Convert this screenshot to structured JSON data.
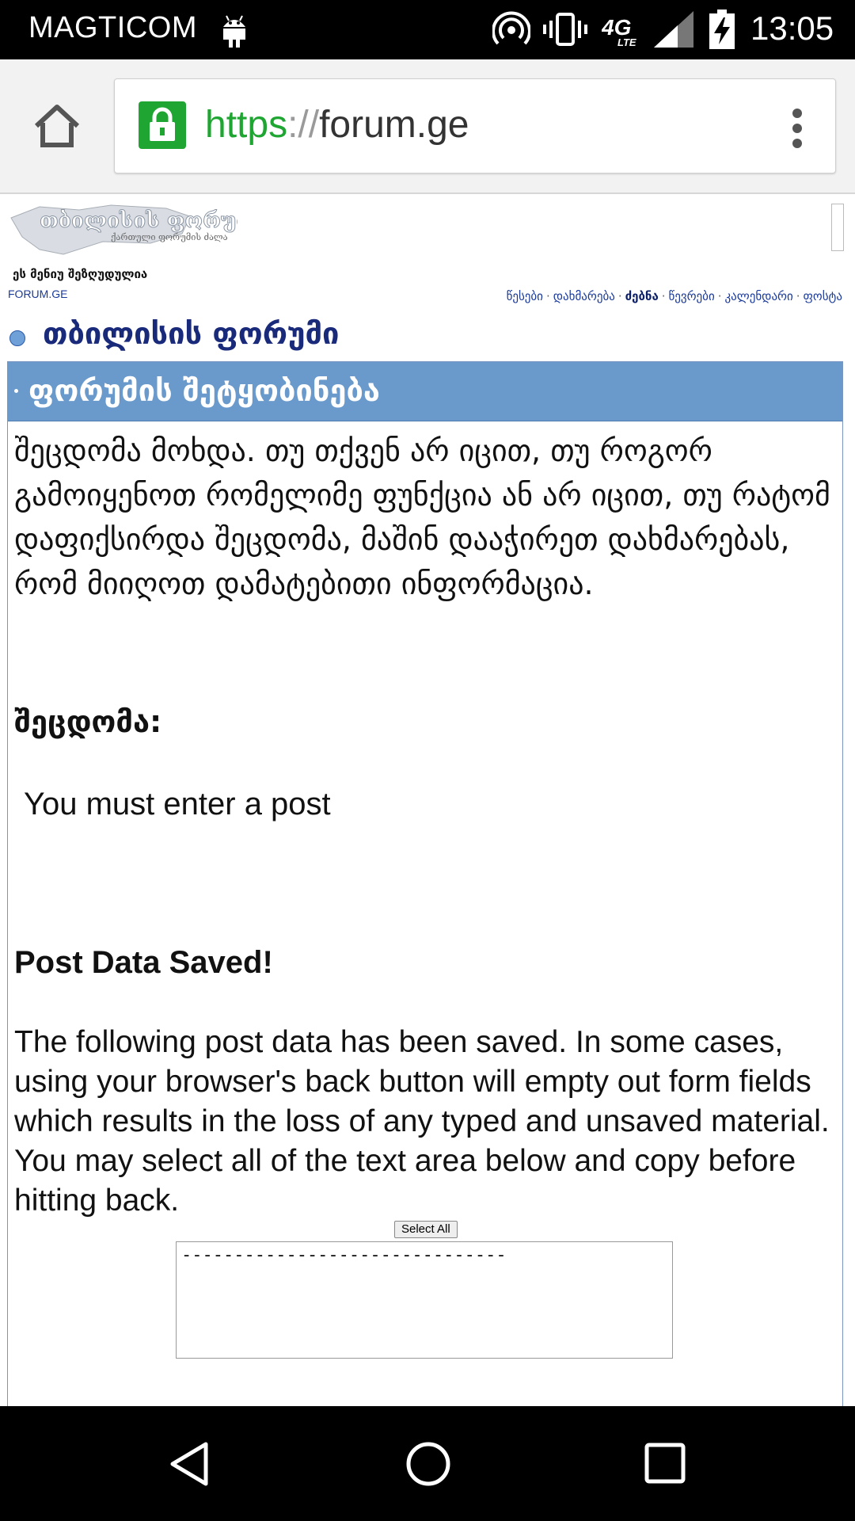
{
  "status_bar": {
    "carrier": "MAGTICOM",
    "network_badge": "4G LTE",
    "time": "13:05",
    "icons": [
      "android-icon",
      "hotspot-icon",
      "vibrate-icon",
      "lte-icon",
      "signal-icon",
      "battery-charging-icon"
    ]
  },
  "browser": {
    "url_scheme": "https",
    "url_sep": "://",
    "url_host": "forum.ge",
    "accent_color": "#1fa632"
  },
  "header": {
    "logo_text": "თბილისის ფორუმი",
    "logo_subtext": "ქართული ფორუმის ძალა",
    "menu_limited": "ეს მენიუ შეზღუდულია",
    "site_link": "FORUM.GE",
    "nav": [
      {
        "label": "წესები"
      },
      {
        "label": "დახმარება"
      },
      {
        "label": "ძებნა"
      },
      {
        "label": "წევრები"
      },
      {
        "label": "კალენდარი"
      },
      {
        "label": "ფოსტა"
      }
    ]
  },
  "forum": {
    "title": "თბილისის ფორუმი"
  },
  "message": {
    "header": "ფორუმის შეტყობინება",
    "intro": "შეცდომა მოხდა. თუ თქვენ არ იცით, თუ როგორ გამოიყენოთ რომელიმე ფუნქცია ან არ იცით, თუ რატომ დაფიქსირდა შეცდომა, მაშინ დააჭირეთ დახმარებას, რომ მიიღოთ დამატებითი ინფორმაცია.",
    "error_label": "შეცდომა:",
    "error_text": "You must enter a post",
    "saved_title": "Post Data Saved!",
    "saved_desc": "The following post data has been saved. In some cases, using your browser's back button will empty out form fields which results in the loss of any typed and unsaved material. You may select all of the text area below and copy before hitting back.",
    "select_all_label": "Select All",
    "textarea_value": "-------------------------------"
  },
  "colors": {
    "header_bar": "#6a9acc",
    "link": "#1a3a9a",
    "title": "#1a2a7a"
  }
}
